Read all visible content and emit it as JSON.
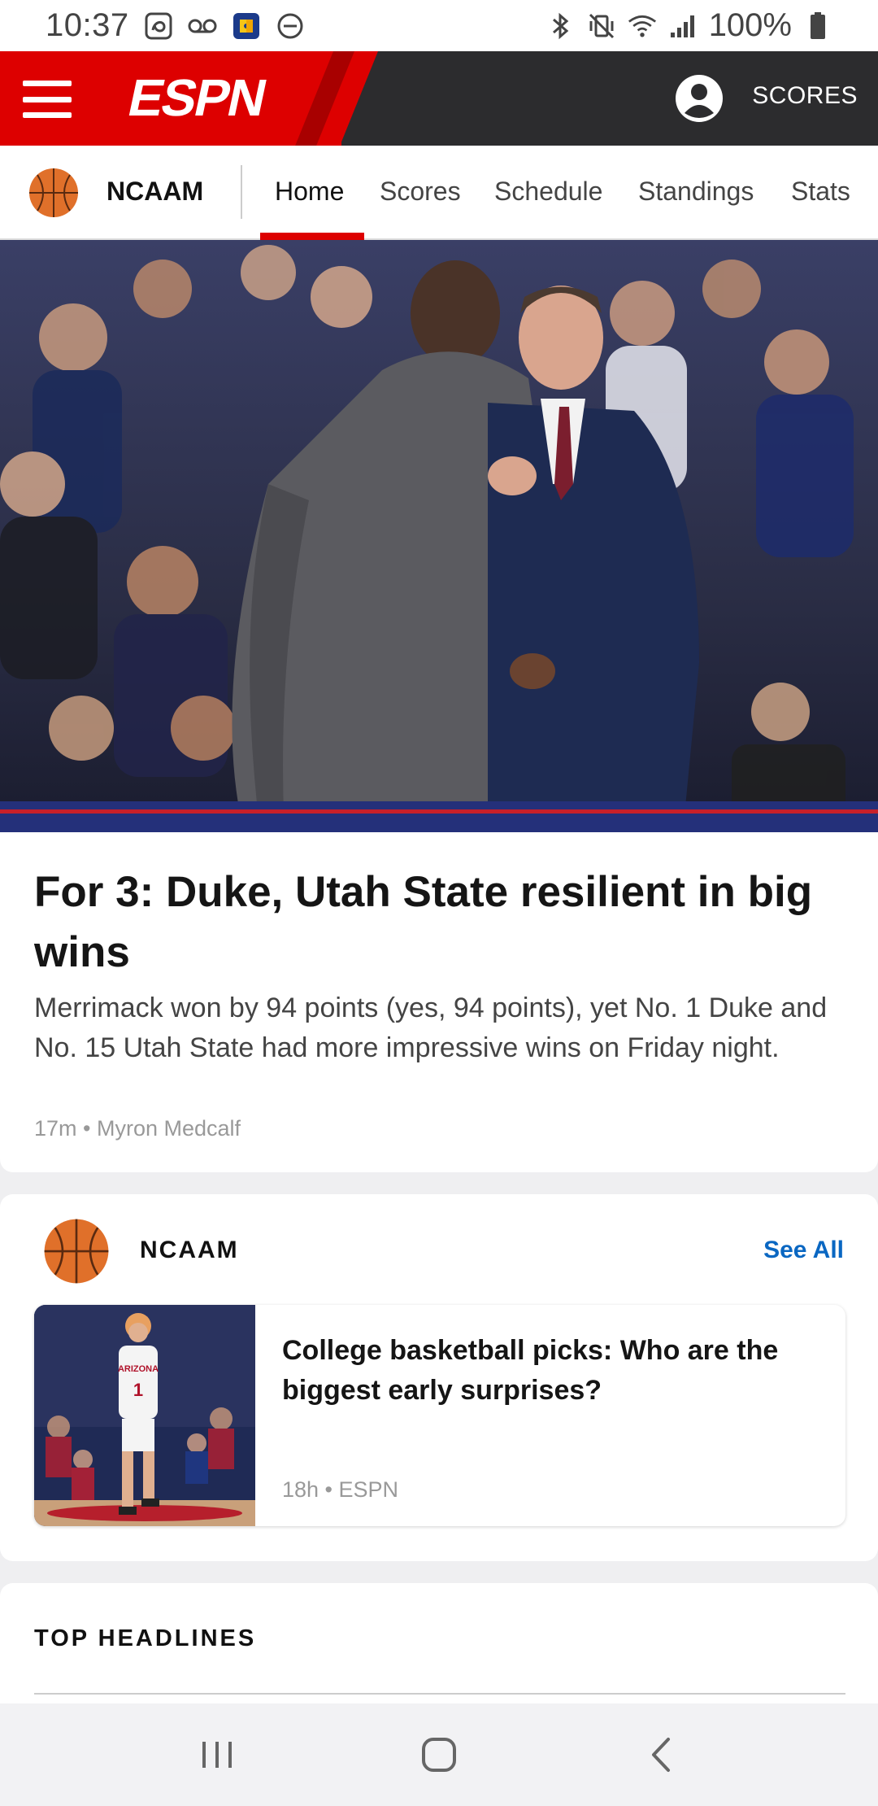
{
  "status_bar": {
    "time": "10:37",
    "battery_text": "100%",
    "icons": [
      "disney-icon",
      "voicemail-icon",
      "puzzle-app-icon",
      "do-not-disturb-icon",
      "bluetooth-icon",
      "vibrate-mute-icon",
      "wifi-icon",
      "signal-icon",
      "battery-icon"
    ]
  },
  "header": {
    "logo": "ESPN",
    "scores_label": "SCORES",
    "brand_red": "#dd0000",
    "header_bg": "#2c2c2e"
  },
  "subnav": {
    "league": "NCAAM",
    "tabs": [
      {
        "label": "Home",
        "active": true
      },
      {
        "label": "Scores",
        "active": false
      },
      {
        "label": "Schedule",
        "active": false
      },
      {
        "label": "Standings",
        "active": false
      },
      {
        "label": "Stats",
        "active": false
      }
    ]
  },
  "hero": {
    "title": "For 3: Duke, Utah State resilient in big wins",
    "summary": "Merrimack won by 94 points (yes, 94 points), yet No. 1 Duke and No. 15 Utah State had more impressive wins on Friday night.",
    "meta": "17m • Myron Medcalf"
  },
  "league_section": {
    "league": "NCAAM",
    "see_all": "See All",
    "link_color": "#0a67c2",
    "story": {
      "title": "College basketball picks: Who are the biggest early surprises?",
      "meta": "18h • ESPN",
      "jersey_text": "ARIZONA",
      "jersey_number": "1"
    }
  },
  "top_headlines": {
    "title": "TOP HEADLINES"
  },
  "nav_bar": {
    "buttons": [
      "recent-apps-icon",
      "home-icon",
      "back-icon"
    ]
  }
}
